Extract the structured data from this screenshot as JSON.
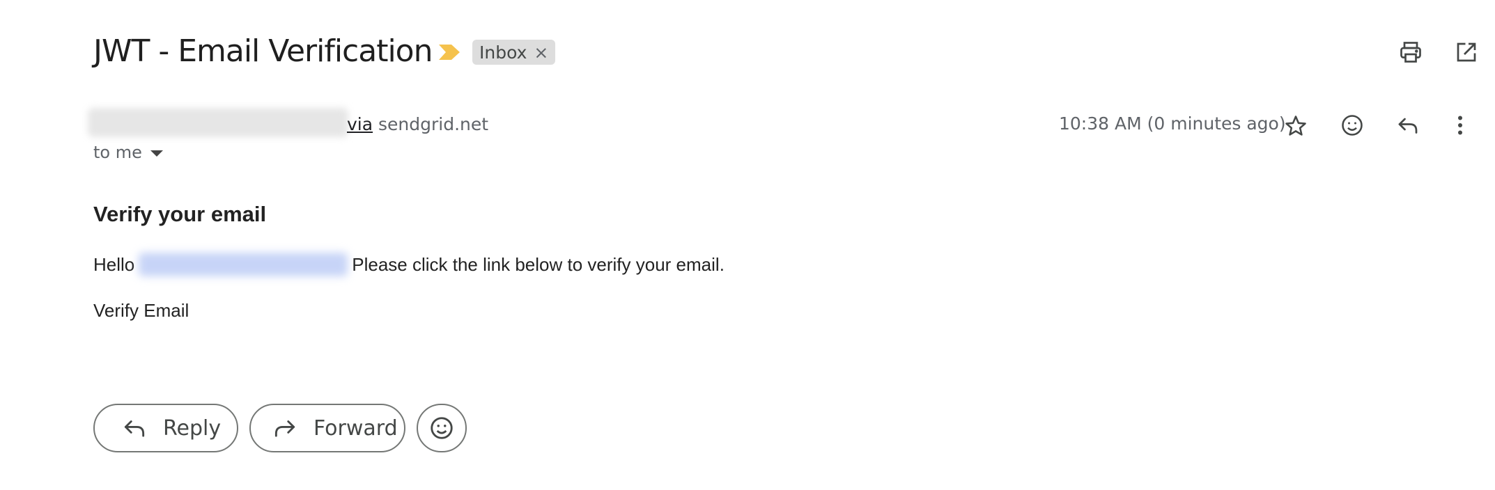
{
  "header": {
    "subject": "JWT - Email Verification",
    "label": "Inbox",
    "label_remove": "×",
    "importance_color": "#f5c24d",
    "icons": [
      "print-icon",
      "open-in-new-window-icon"
    ]
  },
  "message": {
    "via_prefix": "via",
    "via_domain": " sendgrid.net",
    "recipient": "to me",
    "timestamp": "10:38 AM (0 minutes ago)",
    "actions": [
      "star-icon",
      "emoji-icon",
      "reply-icon",
      "more-vert-icon"
    ]
  },
  "body": {
    "title": "Verify your email",
    "greeting": "Hello",
    "instruction": "Please click the link below to verify your email.",
    "verify_link": "Verify Email"
  },
  "footer": {
    "reply_label": "Reply",
    "forward_label": "Forward"
  }
}
